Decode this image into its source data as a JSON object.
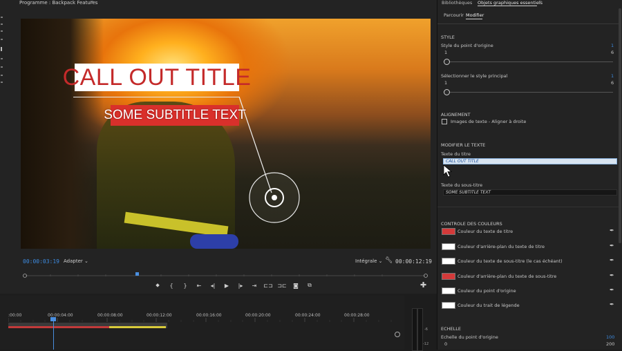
{
  "program": {
    "title": "Programme : Backpack Features",
    "timecode_current": "00:00:03:19",
    "fit": "Adapter",
    "quality": "Intégrale",
    "timecode_duration": "00:00:12:19"
  },
  "overlay": {
    "title": "CALL OUT TITLE",
    "subtitle": "SOME SUBTITLE TEXT"
  },
  "timeline": {
    "ruler": [
      ":00:00",
      "00:00:04:00",
      "00:00:08:00",
      "00:00:12:00",
      "00:00:16:00",
      "00:00:20:00",
      "00:00:24:00",
      "00:00:28:00"
    ],
    "meter": [
      "-6",
      "-12"
    ]
  },
  "panel": {
    "tabs": [
      "Bibliothèques",
      "Objets graphiques essentiels"
    ],
    "subtabs": [
      "Parcourir",
      "Modifier"
    ],
    "style_section": "STYLE",
    "origin_style_label": "Style du point d'origine",
    "origin_style_value": "1",
    "origin_style_min": "1",
    "origin_style_max": "6",
    "main_style_label": "Sélectionner le style principal",
    "main_style_value": "1",
    "main_style_min": "1",
    "main_style_max": "6",
    "align_section": "ALIGNEMENT",
    "align_checkbox": "Images de texte - Aligner à droite",
    "edit_section": "MODIFIER LE TEXTE",
    "title_text_label": "Texte du titre",
    "title_text_value": "CALL OUT TITLE",
    "subtitle_text_label": "Texte du sous-titre",
    "subtitle_text_value": "SOME SUBTITLE TEXT",
    "color_section": "CONTROLE DES COULEURS",
    "colors": [
      {
        "label": "Couleur du texte de titre",
        "swatch": "#d33a3a"
      },
      {
        "label": "Couleur d'arrière-plan du texte de titre",
        "swatch": "#ffffff"
      },
      {
        "label": "Couleur du texte de sous-titre (le cas échéant)",
        "swatch": "#ffffff"
      },
      {
        "label": "Couleur d'arrière-plan du texte de sous-titre",
        "swatch": "#d33a3a"
      },
      {
        "label": "Couleur du point d'origine",
        "swatch": "#ffffff"
      },
      {
        "label": "Couleur du trait de légende",
        "swatch": "#ffffff"
      }
    ],
    "scale_section": "ECHELLE",
    "scale_label": "Echelle du point d'origine",
    "scale_value": "100",
    "scale_min": "0",
    "scale_max": "200"
  },
  "accent_color": "#3d8be0"
}
